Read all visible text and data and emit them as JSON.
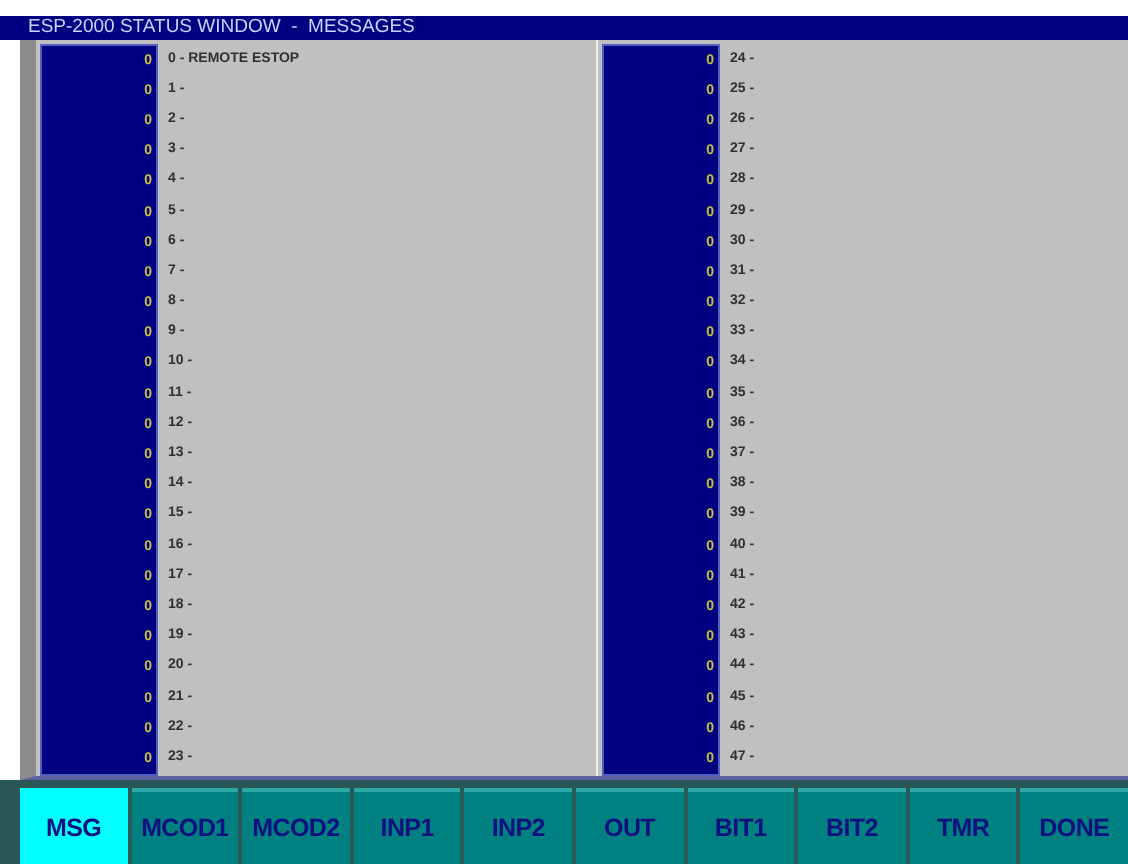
{
  "window": {
    "title": "ESP-2000 STATUS WINDOW  -  MESSAGES"
  },
  "columns": [
    {
      "rows": [
        {
          "value": "0",
          "text": "0 - REMOTE ESTOP"
        },
        {
          "value": "0",
          "text": "1 -"
        },
        {
          "value": "0",
          "text": "2 -"
        },
        {
          "value": "0",
          "text": "3 -"
        },
        {
          "value": "0",
          "text": "4 -"
        },
        {
          "value": "0",
          "text": "5 -"
        },
        {
          "value": "0",
          "text": "6 -"
        },
        {
          "value": "0",
          "text": "7 -"
        },
        {
          "value": "0",
          "text": "8 -"
        },
        {
          "value": "0",
          "text": "9 -"
        },
        {
          "value": "0",
          "text": "10 -"
        },
        {
          "value": "0",
          "text": "11 -"
        },
        {
          "value": "0",
          "text": "12 -"
        },
        {
          "value": "0",
          "text": "13 -"
        },
        {
          "value": "0",
          "text": "14 -"
        },
        {
          "value": "0",
          "text": "15 -"
        },
        {
          "value": "0",
          "text": "16 -"
        },
        {
          "value": "0",
          "text": "17 -"
        },
        {
          "value": "0",
          "text": "18 -"
        },
        {
          "value": "0",
          "text": "19 -"
        },
        {
          "value": "0",
          "text": "20 -"
        },
        {
          "value": "0",
          "text": "21 -"
        },
        {
          "value": "0",
          "text": "22 -"
        },
        {
          "value": "0",
          "text": "23 -"
        }
      ]
    },
    {
      "rows": [
        {
          "value": "0",
          "text": "24 -"
        },
        {
          "value": "0",
          "text": "25 -"
        },
        {
          "value": "0",
          "text": "26 -"
        },
        {
          "value": "0",
          "text": "27 -"
        },
        {
          "value": "0",
          "text": "28 -"
        },
        {
          "value": "0",
          "text": "29 -"
        },
        {
          "value": "0",
          "text": "30 -"
        },
        {
          "value": "0",
          "text": "31 -"
        },
        {
          "value": "0",
          "text": "32 -"
        },
        {
          "value": "0",
          "text": "33 -"
        },
        {
          "value": "0",
          "text": "34 -"
        },
        {
          "value": "0",
          "text": "35 -"
        },
        {
          "value": "0",
          "text": "36 -"
        },
        {
          "value": "0",
          "text": "37 -"
        },
        {
          "value": "0",
          "text": "38 -"
        },
        {
          "value": "0",
          "text": "39 -"
        },
        {
          "value": "0",
          "text": "40 -"
        },
        {
          "value": "0",
          "text": "41 -"
        },
        {
          "value": "0",
          "text": "42 -"
        },
        {
          "value": "0",
          "text": "43 -"
        },
        {
          "value": "0",
          "text": "44 -"
        },
        {
          "value": "0",
          "text": "45 -"
        },
        {
          "value": "0",
          "text": "46 -"
        },
        {
          "value": "0",
          "text": "47 -"
        }
      ]
    }
  ],
  "buttons": [
    {
      "label": "MSG",
      "selected": true
    },
    {
      "label": "MCOD1",
      "selected": false
    },
    {
      "label": "MCOD2",
      "selected": false
    },
    {
      "label": "INP1",
      "selected": false
    },
    {
      "label": "INP2",
      "selected": false
    },
    {
      "label": "OUT",
      "selected": false
    },
    {
      "label": "BIT1",
      "selected": false
    },
    {
      "label": "BIT2",
      "selected": false
    },
    {
      "label": "TMR",
      "selected": false
    },
    {
      "label": "DONE",
      "selected": false
    }
  ]
}
